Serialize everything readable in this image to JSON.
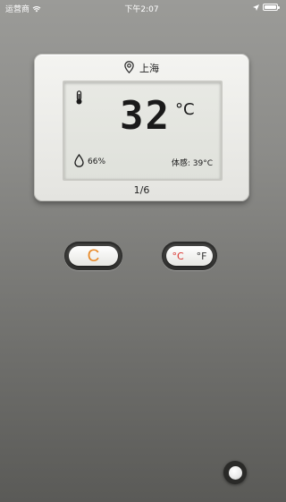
{
  "status_bar": {
    "carrier": "运营商",
    "time": "下午2:07"
  },
  "device": {
    "location": "上海",
    "temperature": "32",
    "temperature_unit": "°C",
    "humidity": "66%",
    "feels_like": "体感: 39°C",
    "page": "1/6"
  },
  "buttons": {
    "celsius_glyph": "C",
    "celsius_label": "°C",
    "fahrenheit_label": "°F"
  },
  "colors": {
    "accent_orange": "#e88a2a",
    "celsius_red": "#d9302a",
    "background_top": "#9b9b98",
    "background_bottom": "#5a5a57"
  },
  "icons": {
    "location": "location-pin-icon",
    "thermometer": "thermometer-icon",
    "humidity": "water-drop-icon",
    "wifi": "wifi-icon",
    "gps": "location-arrow-icon",
    "battery": "battery-icon"
  }
}
